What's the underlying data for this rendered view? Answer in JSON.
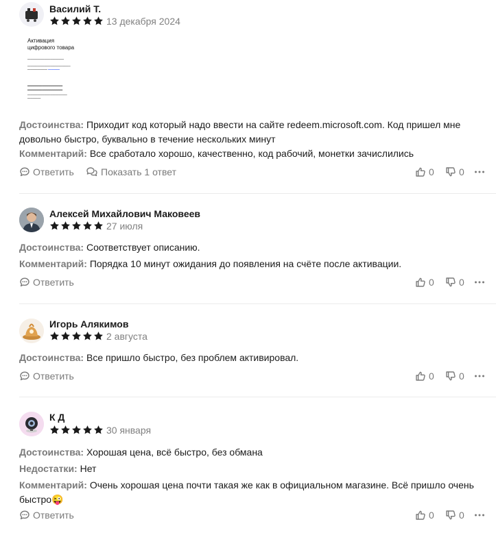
{
  "reviews": [
    {
      "author": "Василий Т.",
      "date": "13 декабря 2024",
      "rating": 5,
      "photo": {
        "title_line1": "Активация",
        "title_line2": "цифрового товара"
      },
      "pros_label": "Достоинства:",
      "pros": "Приходит код который надо ввести на сайте redeem.microsoft.com. Код пришел мне довольно быстро, буквально в течение нескольких минут",
      "comment_label": "Комментарий:",
      "comment": "Все сработало хорошо, качественно, код рабочий, монетки зачислились",
      "reply_label": "Ответить",
      "show_replies_label": "Показать 1 ответ",
      "likes": "0",
      "dislikes": "0"
    },
    {
      "author": "Алексей Михайлович Маковеев",
      "date": "27 июля",
      "rating": 5,
      "pros_label": "Достоинства:",
      "pros": "Соответствует описанию.",
      "comment_label": "Комментарий:",
      "comment": "Порядка 10 минут ожидания до появления на счёте после активации.",
      "reply_label": "Ответить",
      "likes": "0",
      "dislikes": "0"
    },
    {
      "author": "Игорь Алякимов",
      "date": "2 августа",
      "rating": 5,
      "pros_label": "Достоинства:",
      "pros": "Все пришло быстро, без проблем активировал.",
      "reply_label": "Ответить",
      "likes": "0",
      "dislikes": "0"
    },
    {
      "author": "К Д",
      "date": "30 января",
      "rating": 5,
      "pros_label": "Достоинства:",
      "pros": "Хорошая цена, всё быстро, без обмана",
      "cons_label": "Недостатки:",
      "cons": "Нет",
      "comment_label": "Комментарий:",
      "comment": "Очень хорошая цена почти такая же как в официальном магазине. Всё пришло очень быстро",
      "comment_emoji": "😜",
      "reply_label": "Ответить",
      "likes": "0",
      "dislikes": "0"
    }
  ],
  "colors": {
    "label": "#7a7a7a",
    "star": "#1a1a1a",
    "divider": "#ebebeb"
  },
  "icons": [
    "star-icon",
    "comment-icon",
    "comments-icon",
    "thumb-up-icon",
    "thumb-down-icon",
    "more-icon"
  ]
}
